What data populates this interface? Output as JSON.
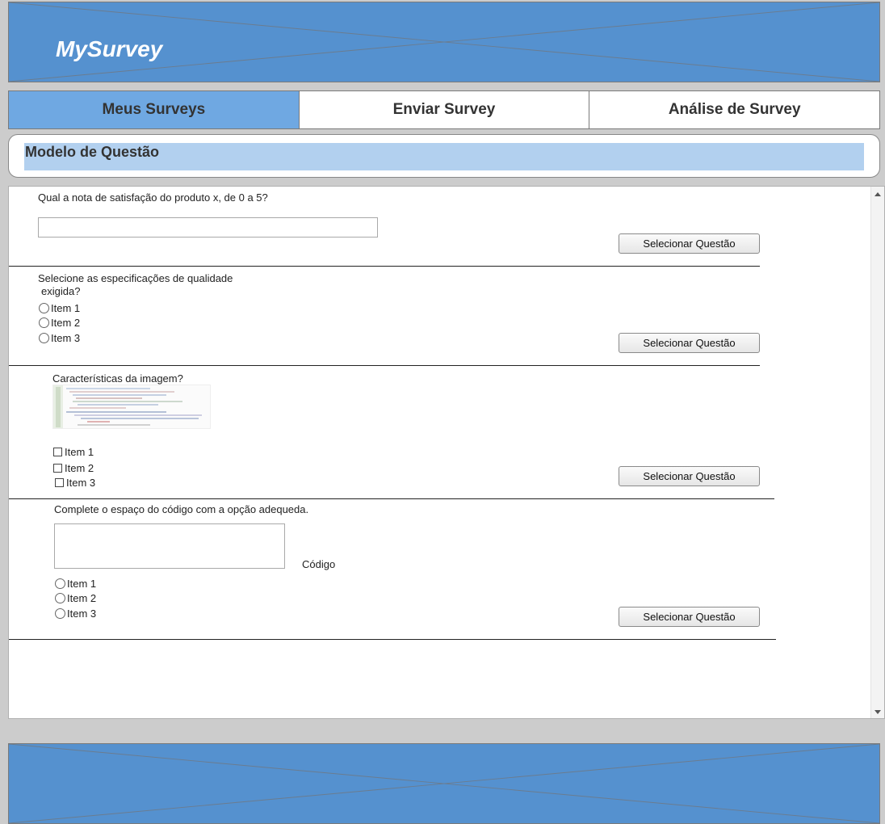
{
  "header": {
    "logo": "MySurvey"
  },
  "tabs": [
    {
      "label": "Meus Surveys",
      "active": true
    },
    {
      "label": "Enviar Survey",
      "active": false
    },
    {
      "label": "Análise de Survey",
      "active": false
    }
  ],
  "section": {
    "title": "Modelo de Questão"
  },
  "questions": [
    {
      "text": "Qual a nota de satisfação do produto x, de 0 a 5?",
      "input_value": "",
      "button": "Selecionar Questão"
    },
    {
      "text_line1": "Selecione as especificações de qualidade",
      "text_line2": "exigida?",
      "options": [
        "Item 1",
        "Item 2",
        "Item 3"
      ],
      "button": "Selecionar Questão"
    },
    {
      "text": "Características da imagem?",
      "options": [
        "Item 1",
        "Item 2",
        "Item 3"
      ],
      "button": "Selecionar Questão"
    },
    {
      "text": "Complete o espaço do código com a opção adequeda.",
      "code_label": "Código",
      "options": [
        "Item 1",
        "Item 2",
        "Item 3"
      ],
      "button": "Selecionar Questão"
    }
  ],
  "colors": {
    "banner": "#5591cf",
    "tab_active": "#6fa8e2",
    "section_title_bg": "#b2d0ef",
    "page_bg": "#cccccc"
  },
  "icons": [
    "radio-icon",
    "checkbox-icon",
    "scroll-up-icon",
    "scroll-down-icon"
  ]
}
